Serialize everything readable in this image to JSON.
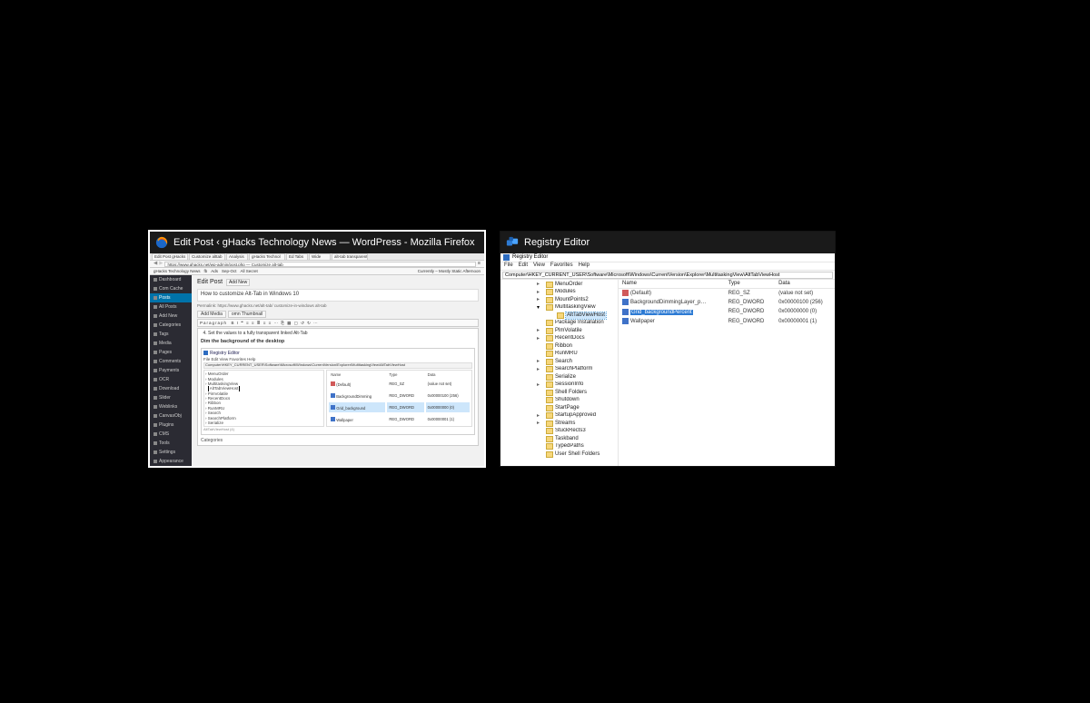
{
  "alttab": {
    "windows": [
      {
        "selected": true,
        "title": "Edit Post ‹ gHacks Technology News — WordPress - Mozilla Firefox"
      },
      {
        "selected": false,
        "title": "Registry Editor"
      }
    ]
  },
  "firefox": {
    "tabs": [
      "Edit Post gHacks",
      "Customize alttab",
      "Analysis",
      "gHacks Technol",
      "Ed Tabs",
      "Wide",
      "alt-tab transparent"
    ],
    "url": "https://www.ghacks.net/wp-admin/post.php — Customize alt-tab",
    "bookmarks": [
      "gHacks Technology News",
      "fb",
      "Ads",
      "Sep-Oct",
      "All Secret"
    ],
    "rightmeta": "Currently – Mostly Static Afternoon",
    "sidebar": [
      "Dashboard",
      "Com Cache",
      "Posts",
      "All Posts",
      "Add New",
      "Categories",
      "Tags",
      "Media",
      "Pages",
      "Comments",
      "Payments",
      "OCR",
      "Download",
      "Slider",
      "Weblinks",
      "CanvasObj",
      "Plugins",
      "CMS",
      "Tools",
      "Settings",
      "Appearance"
    ],
    "sidebar_active_idx": 2,
    "heading": "Edit Post",
    "heading_btn": "Add New",
    "post_title": "How to customize Alt-Tab in Windows 10",
    "permalink": "Permalink: https://www.ghacks.net/alt-tab/ customize-in-windows alt-tab",
    "mediabtns": [
      "Add Media",
      "omn Thumbnail"
    ],
    "toolbar_glyphs": "B  I  ❝  ≡  ≡  ≣  ≡  ≡  ⋯  ⎘  ▦  ▢  ↺  ↻  ⋯",
    "paragraph_label": "Paragraph",
    "li1": "Set the values to a fully transparent linked Alt-Tab",
    "subhead": "Dim the background of the desktop",
    "embed_title": "Registry Editor",
    "embed_menu": "File  Edit  View  Favorites  Help",
    "embed_path": "Computer\\HKEY_CURRENT_USER\\Software\\Microsoft\\Windows\\CurrentVersion\\Explorer\\MultitaskingView\\AltTabViewHost",
    "embed_tree": [
      "MenuOrder",
      "Modules",
      "MultitaskingView",
      "AltTabViewHost",
      "PimVolatile",
      "RecentDocs",
      "Ribbon",
      "RunMRU",
      "Search",
      "SearchPlatform",
      "Serialize"
    ],
    "embed_sel_idx": 3,
    "embed_cols": [
      "Name",
      "Type",
      "Data"
    ],
    "embed_rows": [
      {
        "n": "(Default)",
        "t": "REG_SZ",
        "d": "(value not set)",
        "hl": false,
        "ic": "sz"
      },
      {
        "n": "BackgroundDimming",
        "t": "REG_DWORD",
        "d": "0x00000100 (256)",
        "hl": false,
        "ic": "dw"
      },
      {
        "n": "Grid_background",
        "t": "REG_DWORD",
        "d": "0x00000000 (0)",
        "hl": true,
        "ic": "dw"
      },
      {
        "n": "Wallpaper",
        "t": "REG_DWORD",
        "d": "0x00000001 (1)",
        "hl": false,
        "ic": "dw"
      }
    ],
    "embed_footer": "AltTabViewHost  (4)",
    "meta_label": "Categories"
  },
  "regedit": {
    "wintitle": "Registry Editor",
    "menu": [
      "File",
      "Edit",
      "View",
      "Favorites",
      "Help"
    ],
    "path": "Computer\\HKEY_CURRENT_USER\\Software\\Microsoft\\Windows\\CurrentVersion\\Explorer\\MultitaskingView\\AltTabViewHost",
    "tree": [
      {
        "label": "MenuOrder",
        "state": "closed"
      },
      {
        "label": "Modules",
        "state": "closed"
      },
      {
        "label": "MountPoints2",
        "state": "closed"
      },
      {
        "label": "MultitaskingView",
        "state": "open"
      },
      {
        "label": "AltTabViewHost",
        "state": "none",
        "child": true,
        "selected": true
      },
      {
        "label": "Package Installation",
        "state": "none"
      },
      {
        "label": "PlmVolatile",
        "state": "closed"
      },
      {
        "label": "RecentDocs",
        "state": "closed"
      },
      {
        "label": "Ribbon",
        "state": "none"
      },
      {
        "label": "RunMRU",
        "state": "none"
      },
      {
        "label": "Search",
        "state": "closed"
      },
      {
        "label": "SearchPlatform",
        "state": "closed"
      },
      {
        "label": "Serialize",
        "state": "none"
      },
      {
        "label": "SessionInfo",
        "state": "closed"
      },
      {
        "label": "Shell Folders",
        "state": "none"
      },
      {
        "label": "Shutdown",
        "state": "none"
      },
      {
        "label": "StartPage",
        "state": "none"
      },
      {
        "label": "StartupApproved",
        "state": "closed"
      },
      {
        "label": "Streams",
        "state": "closed"
      },
      {
        "label": "StuckRects3",
        "state": "none"
      },
      {
        "label": "Taskband",
        "state": "none"
      },
      {
        "label": "TypedPaths",
        "state": "none"
      },
      {
        "label": "User Shell Folders",
        "state": "none"
      }
    ],
    "cols": [
      "Name",
      "Type",
      "Data"
    ],
    "rows": [
      {
        "name": "(Default)",
        "type": "REG_SZ",
        "data": "(value not set)",
        "icon": "sz",
        "hl": false
      },
      {
        "name": "BackgroundDimmingLayer_p…",
        "type": "REG_DWORD",
        "data": "0x00000100 (256)",
        "icon": "dw",
        "hl": false
      },
      {
        "name": "Grid_backgroundPercent",
        "type": "REG_DWORD",
        "data": "0x00000000 (0)",
        "icon": "dw",
        "hl": true
      },
      {
        "name": "Wallpaper",
        "type": "REG_DWORD",
        "data": "0x00000001 (1)",
        "icon": "dw",
        "hl": false
      }
    ]
  }
}
